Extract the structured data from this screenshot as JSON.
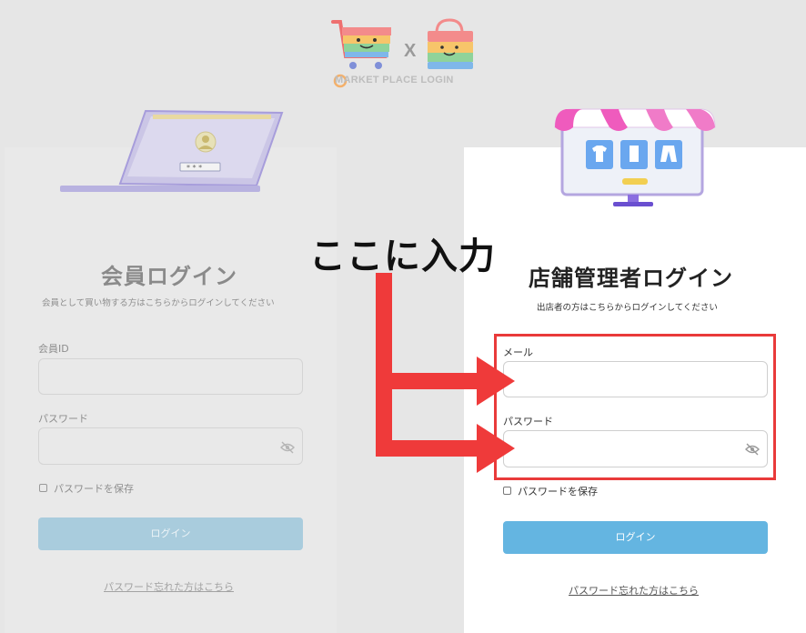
{
  "header": {
    "logo_text": "MARKET PLACE LOGIN",
    "separator": "X"
  },
  "member": {
    "title": "会員ログイン",
    "subtitle": "会員として買い物する方はこちらからログインしてください",
    "id_label": "会員ID",
    "id_value": "",
    "password_label": "パスワード",
    "password_value": "",
    "save_password_label": "パスワードを保存",
    "login_button": "ログイン",
    "forgot_link": "パスワード忘れた方はこちら"
  },
  "admin": {
    "title": "店舗管理者ログイン",
    "subtitle": "出店者の方はこちらからログインしてください",
    "mail_label": "メール",
    "mail_value": "",
    "password_label": "パスワード",
    "password_value": "",
    "save_password_label": "パスワードを保存",
    "login_button": "ログイン",
    "forgot_link": "パスワード忘れた方はこちら"
  },
  "annotation": {
    "text": "ここに入力"
  },
  "colors": {
    "accent_button": "#64b5e1",
    "faded_button": "#a9ccdd",
    "annotation_red": "#e93a3a"
  },
  "icons": [
    "cart-logo-icon",
    "bag-logo-icon",
    "laptop-illustration",
    "storefront-illustration",
    "eye-off-icon"
  ]
}
